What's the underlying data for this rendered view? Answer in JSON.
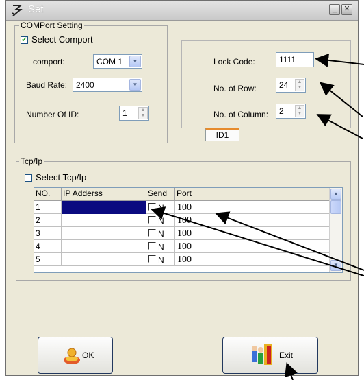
{
  "window": {
    "title": "Set"
  },
  "comport": {
    "legend": "COMPort Setting",
    "select_label": "Select Comport",
    "select_checked": true,
    "comport_label": "comport:",
    "comport_value": "COM 1",
    "baud_label": "Baud Rate:",
    "baud_value": "2400",
    "id_label": "Number Of ID:",
    "id_value": "1"
  },
  "display": {
    "lock_label": "Lock Code:",
    "lock_value": "1111",
    "rows_label": "No. of Row:",
    "rows_value": "24",
    "cols_label": "No. of Column:",
    "cols_value": "2",
    "tab_label": "ID1"
  },
  "tcpip": {
    "legend": "Tcp/Ip",
    "select_label": "Select Tcp/Ip",
    "select_checked": false,
    "columns": [
      "NO.",
      "IP Adderss",
      "Send",
      "Port"
    ],
    "rows": [
      {
        "no": "1",
        "ip": "",
        "send": "N",
        "port": "100"
      },
      {
        "no": "2",
        "ip": "",
        "send": "N",
        "port": "100"
      },
      {
        "no": "3",
        "ip": "",
        "send": "N",
        "port": "100"
      },
      {
        "no": "4",
        "ip": "",
        "send": "N",
        "port": "100"
      },
      {
        "no": "5",
        "ip": "",
        "send": "N",
        "port": "100"
      }
    ]
  },
  "buttons": {
    "ok_label": "OK",
    "exit_label": "Exit"
  },
  "colors": {
    "selection": "#0a0a80",
    "window_bg": "#ece9d8",
    "tab_accent": "#e68b2c"
  }
}
